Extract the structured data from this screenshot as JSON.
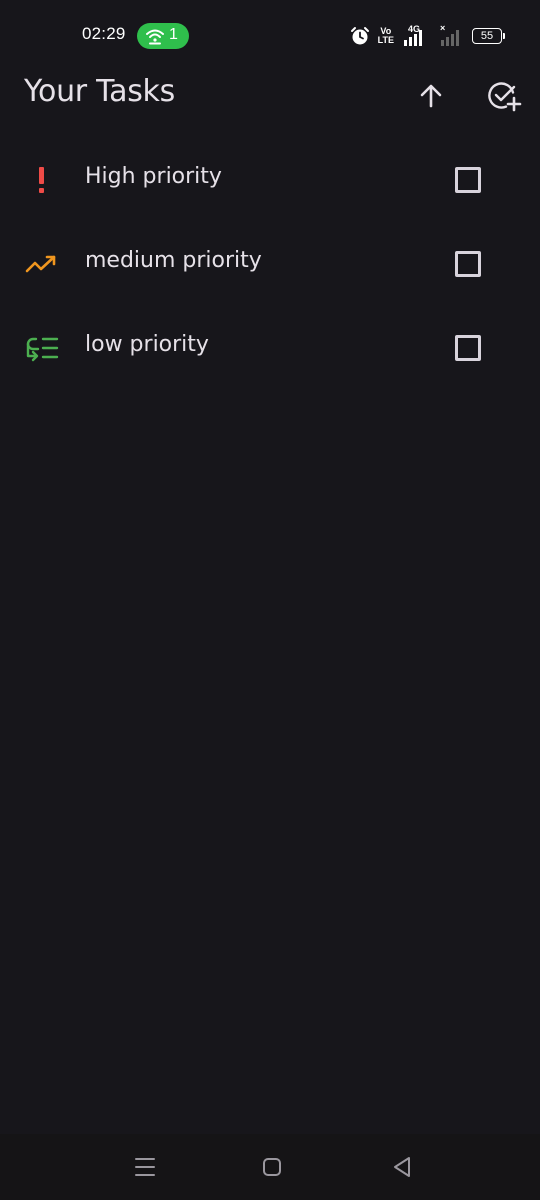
{
  "status_bar": {
    "time": "02:29",
    "hotspot_count": "1",
    "volte_top": "Vo",
    "volte_bottom": "LTE",
    "network_type": "4G",
    "sim2_status": "×",
    "battery_level": "55"
  },
  "app_bar": {
    "title": "Your Tasks",
    "icons": [
      "arrow-up-icon",
      "add-task-icon"
    ]
  },
  "tasks": [
    {
      "label": "High priority",
      "priority_icon": "exclamation-icon",
      "icon_color": "#ef4b47",
      "checked": false
    },
    {
      "label": "medium priority",
      "priority_icon": "trending-up-icon",
      "icon_color": "#f0961f",
      "checked": false
    },
    {
      "label": "low priority",
      "priority_icon": "low-priority-icon",
      "icon_color": "#4caf50",
      "checked": false
    }
  ],
  "nav_bar": {
    "icons": [
      "menu-icon",
      "home-icon",
      "back-icon"
    ]
  },
  "colors": {
    "background": "#17161b",
    "text": "#e6e1e8",
    "hotspot_green": "#2fbf4c",
    "high": "#ef4b47",
    "medium": "#f0961f",
    "low": "#4caf50"
  }
}
